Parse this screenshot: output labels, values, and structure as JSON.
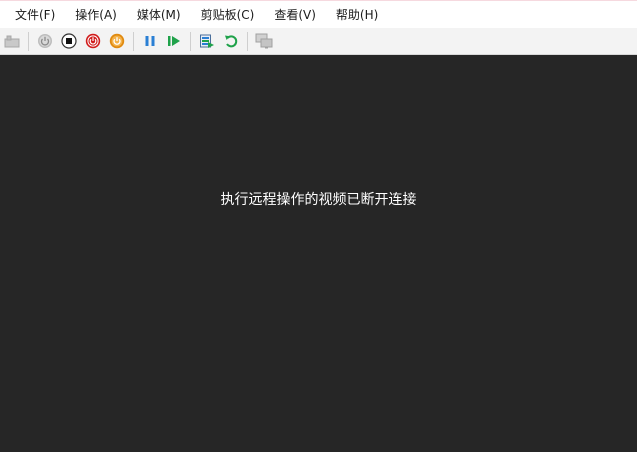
{
  "menu": {
    "file": "文件(F)",
    "action": "操作(A)",
    "media": "媒体(M)",
    "clipboard": "剪贴板(C)",
    "view": "查看(V)",
    "help": "帮助(H)"
  },
  "toolbar": {
    "icons": [
      "ctrl-alt-del-icon",
      "start-icon",
      "turn-off-icon",
      "shut-down-icon",
      "save-state-icon",
      "pause-icon",
      "resume-icon",
      "checkpoint-icon",
      "revert-icon",
      "enhanced-session-icon"
    ]
  },
  "viewport": {
    "message": "执行远程操作的视频已断开连接"
  },
  "colors": {
    "background": "#262626",
    "shutdown_red": "#d11c1c",
    "save_orange": "#e08a10",
    "pause_blue": "#2a7fd4",
    "resume_green": "#1fa24a"
  }
}
